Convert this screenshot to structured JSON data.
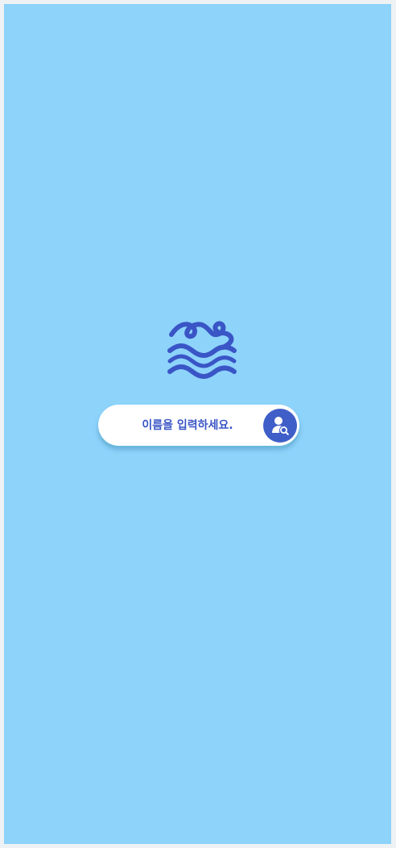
{
  "app": {
    "logo_icon": "waves-icon"
  },
  "search": {
    "placeholder": "이름을 입력하세요.",
    "value": "",
    "button_icon": "user-search-icon"
  },
  "colors": {
    "background": "#8dd3fa",
    "accent": "#3f5ec7",
    "text": "#3a55c6",
    "input_background": "#ffffff"
  }
}
